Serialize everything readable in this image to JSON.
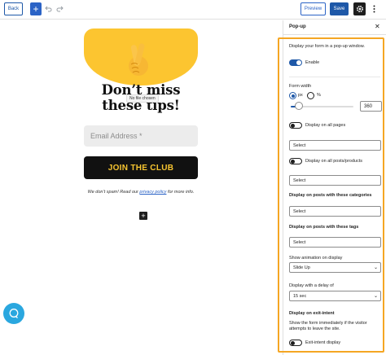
{
  "toolbar": {
    "back_label": "Back",
    "add_label": "+",
    "undo_icon": "undo-icon",
    "redo_icon": "redo-icon",
    "preview_label": "Preview",
    "save_label": "Save",
    "settings_icon": "gear-icon",
    "more_icon": "vertical-dots-icon"
  },
  "canvas": {
    "headline": "Don’t miss these tips!",
    "file_tooltip": "No file chosen",
    "email_placeholder": "Email Address *",
    "cta_label": "JOIN THE CLUB",
    "disclaimer_before": "We don’t spam! Read our ",
    "disclaimer_link": "privacy policy",
    "disclaimer_after": " for more info.",
    "add_block": "+",
    "hero_color": "#fcc530",
    "cta_text_color": "#f7c530"
  },
  "sidebar": {
    "title": "Pop-up",
    "intro": "Display your form in a pop-up window.",
    "enable_label": "Enable",
    "enable_on": true,
    "form_width_label": "Form width",
    "unit_px": "px",
    "unit_percent": "%",
    "width_value": "360",
    "slider_fraction": 0.13,
    "display_all_pages_label": "Display on all pages",
    "select_pages_placeholder": "Select",
    "display_all_posts_label": "Display on all posts/products",
    "select_posts_placeholder": "Select",
    "categories_label": "Display on posts with these categories",
    "select_categories_placeholder": "Select",
    "tags_label": "Display on posts with these tags",
    "select_tags_placeholder": "Select",
    "animation_label": "Show animation on display",
    "animation_value": "Slide Up",
    "delay_label": "Display with a delay of",
    "delay_value": "15 sec",
    "exit_intent_heading": "Display on exit-intent",
    "exit_intent_desc": "Show the form immediately if the visitor attempts to leave the site.",
    "exit_intent_toggle_label": "Exit-intent display"
  },
  "colors": {
    "accent": "#1e58a8",
    "highlight": "#f5a623",
    "chat": "#2aa7df"
  }
}
